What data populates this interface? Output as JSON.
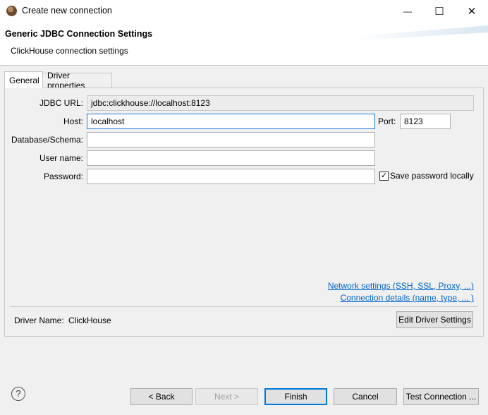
{
  "window": {
    "title": "Create new connection",
    "minimize_glyph": "—",
    "maximize_glyph": "☐",
    "close_glyph": "✕"
  },
  "header": {
    "title": "Generic JDBC Connection Settings",
    "subtitle": "ClickHouse connection settings"
  },
  "tabs": [
    {
      "label": "General",
      "selected": true
    },
    {
      "label": "Driver properties",
      "selected": false
    }
  ],
  "form": {
    "jdbc_url_label": "JDBC URL:",
    "jdbc_url_value": "jdbc:clickhouse://localhost:8123",
    "host_label": "Host:",
    "host_value": "localhost",
    "port_label": "Port:",
    "port_value": "8123",
    "database_label": "Database/Schema:",
    "database_value": "",
    "username_label": "User name:",
    "username_value": "",
    "password_label": "Password:",
    "password_value": "",
    "save_password_label": "Save password locally",
    "save_password_checked": true
  },
  "links": {
    "network": "Network settings (SSH, SSL, Proxy, ...)",
    "connection_details": "Connection details (name, type, ... )"
  },
  "driver": {
    "label": "Driver Name:",
    "value": "ClickHouse",
    "edit_button": "Edit Driver Settings"
  },
  "footer": {
    "help_glyph": "?",
    "back": "< Back",
    "next": "Next >",
    "finish": "Finish",
    "cancel": "Cancel",
    "test": "Test Connection ..."
  },
  "colors": {
    "link": "#0066cc",
    "focus_border": "#1f7bd6",
    "primary_border": "#0078d7"
  }
}
